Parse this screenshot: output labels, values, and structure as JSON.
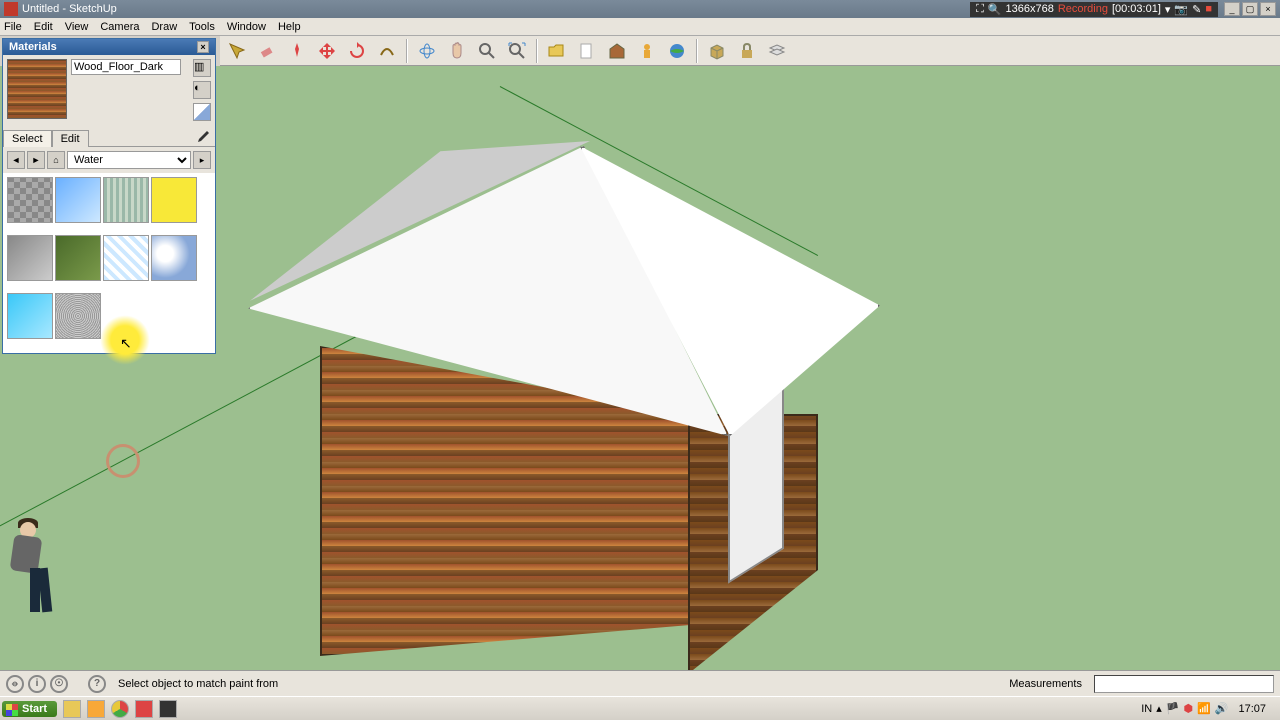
{
  "window": {
    "title": "Untitled - SketchUp"
  },
  "recording": {
    "resolution": "1366x768",
    "label": "Recording",
    "time": "[00:03:01]"
  },
  "menu": [
    "File",
    "Edit",
    "View",
    "Camera",
    "Draw",
    "Tools",
    "Window",
    "Help"
  ],
  "materials": {
    "panel_title": "Materials",
    "current_name": "Wood_Floor_Dark",
    "tabs": {
      "select": "Select",
      "edit": "Edit"
    },
    "category": "Water",
    "swatches": [
      {
        "name": "rock-gray",
        "css": "background:repeating-conic-gradient(#888 0 25%, #aaa 0 50%) 0/12px 12px"
      },
      {
        "name": "water-blue-grad",
        "css": "background:linear-gradient(135deg,#6ab0ff,#cde8ff)"
      },
      {
        "name": "water-stripes",
        "css": "background:repeating-linear-gradient(90deg,#9ab8a8 0 3px,#c8d8c8 3px 6px)"
      },
      {
        "name": "yellow",
        "css": "background:#f8e838"
      },
      {
        "name": "gray-grad",
        "css": "background:linear-gradient(135deg,#888,#ccc)"
      },
      {
        "name": "green-grad",
        "css": "background:linear-gradient(135deg,#4a6a2a,#7a9a4a)"
      },
      {
        "name": "water-grid",
        "css": "background:repeating-linear-gradient(45deg,#cde8ff 0 4px,#fff 4px 8px),repeating-linear-gradient(-45deg,#cde8ff 0 4px,transparent 4px 8px)"
      },
      {
        "name": "sky-clouds",
        "css": "background:radial-gradient(circle at 30% 40%,#fff 20%,#88a8d8 60%)"
      },
      {
        "name": "cyan-grad",
        "css": "background:linear-gradient(135deg,#3ac8f8,#a8e8ff)"
      },
      {
        "name": "noise-gray",
        "css": "background:repeating-radial-gradient(#999 0 1px,#ccc 1px 2px)"
      }
    ]
  },
  "toolbar_icons": [
    "select",
    "eraser",
    "pushpin",
    "move",
    "rotate",
    "offset",
    "sep",
    "orbit",
    "pan",
    "zoom",
    "zoom-extents",
    "sep",
    "folder",
    "new",
    "3dwarehouse",
    "person",
    "globe",
    "sep",
    "box",
    "lock",
    "layers"
  ],
  "status": {
    "message": "Select object to match paint from",
    "measurements_label": "Measurements"
  },
  "taskbar": {
    "start": "Start",
    "lang": "IN",
    "clock": "17:07"
  }
}
